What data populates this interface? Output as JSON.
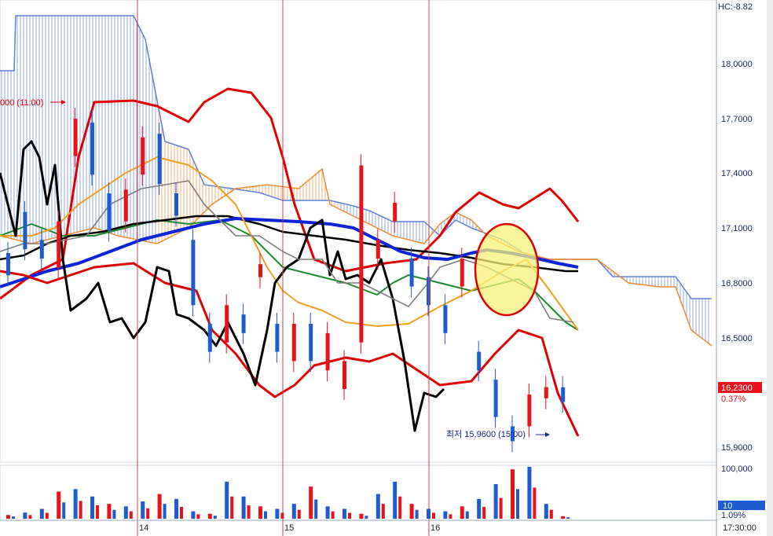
{
  "chart_data": {
    "type": "candlestick",
    "price_axis": {
      "ticks": [
        "18,0000",
        "17,7000",
        "17,4000",
        "17,1000",
        "16,8000",
        "16,5000",
        "16,2300",
        "15,9000"
      ],
      "top_label": "HC:-8.82"
    },
    "volume_axis": {
      "ticks": [
        "100,000",
        "10",
        "1.09%"
      ]
    },
    "x_axis": {
      "ticks": [
        "14",
        "15",
        "16"
      ],
      "last_label": "17:30:00"
    },
    "annotations": {
      "high_label": "000 (11:00)",
      "low_label": "최저 15,9600 (15:00)",
      "current_price": "16,2300",
      "change_pct": "0.37%"
    },
    "colors": {
      "up": "#e8121a",
      "down": "#1e5bd0",
      "bollinger": "#e00000",
      "ma_long": "#0a24d8",
      "ma_mid": "#000000",
      "ma_short": "#f0a020",
      "ma_green": "#1a8a2a",
      "cloud_blue": "#5f7fd8",
      "cloud_orange": "#f08a30",
      "highlight": "#f6f27a"
    },
    "series": [
      {
        "name": "candles",
        "values": [
          [
            "o",
            16.98,
            "c",
            16.86
          ],
          [
            "o",
            17.2,
            "c",
            17.0
          ],
          [
            "o",
            17.05,
            "c",
            16.95
          ],
          [
            "o",
            16.9,
            "c",
            17.15
          ],
          [
            "o",
            17.5,
            "c",
            17.7
          ],
          [
            "o",
            17.68,
            "c",
            17.4
          ],
          [
            "o",
            17.3,
            "c",
            17.1
          ],
          [
            "o",
            17.15,
            "c",
            17.32
          ],
          [
            "o",
            17.4,
            "c",
            17.6
          ],
          [
            "o",
            17.62,
            "c",
            17.35
          ],
          [
            "o",
            17.3,
            "c",
            17.18
          ],
          [
            "o",
            17.05,
            "c",
            16.7
          ],
          [
            "o",
            16.6,
            "c",
            16.45
          ],
          [
            "o",
            16.5,
            "c",
            16.7
          ],
          [
            "o",
            16.65,
            "c",
            16.55
          ],
          [
            "o",
            16.85,
            "c",
            16.92
          ],
          [
            "o",
            16.6,
            "c",
            16.45
          ],
          [
            "o",
            16.4,
            "c",
            16.6
          ],
          [
            "o",
            16.6,
            "c",
            16.4
          ],
          [
            "o",
            16.35,
            "c",
            16.55
          ],
          [
            "o",
            16.25,
            "c",
            16.4
          ],
          [
            "o",
            16.5,
            "c",
            17.45
          ],
          [
            "o",
            16.95,
            "c",
            17.05
          ],
          [
            "o",
            17.15,
            "c",
            17.25
          ],
          [
            "o",
            16.95,
            "c",
            16.8
          ],
          [
            "o",
            16.85,
            "c",
            16.7
          ],
          [
            "o",
            16.7,
            "c",
            16.55
          ],
          [
            "o",
            16.8,
            "c",
            16.95
          ],
          [
            "o",
            16.45,
            "c",
            16.35
          ],
          [
            "o",
            16.3,
            "c",
            16.1
          ],
          [
            "o",
            16.05,
            "c",
            15.97
          ],
          [
            "o",
            16.05,
            "c",
            16.22
          ],
          [
            "o",
            16.2,
            "c",
            16.26
          ],
          [
            "o",
            16.26,
            "c",
            16.18
          ]
        ]
      },
      {
        "name": "volume",
        "values": [
          3,
          5,
          8,
          22,
          24,
          18,
          12,
          10,
          14,
          20,
          16,
          6,
          4,
          30,
          18,
          10,
          8,
          12,
          26,
          10,
          8,
          4,
          20,
          30,
          12,
          8,
          6,
          10,
          16,
          28,
          40,
          42,
          12,
          2
        ]
      }
    ]
  }
}
